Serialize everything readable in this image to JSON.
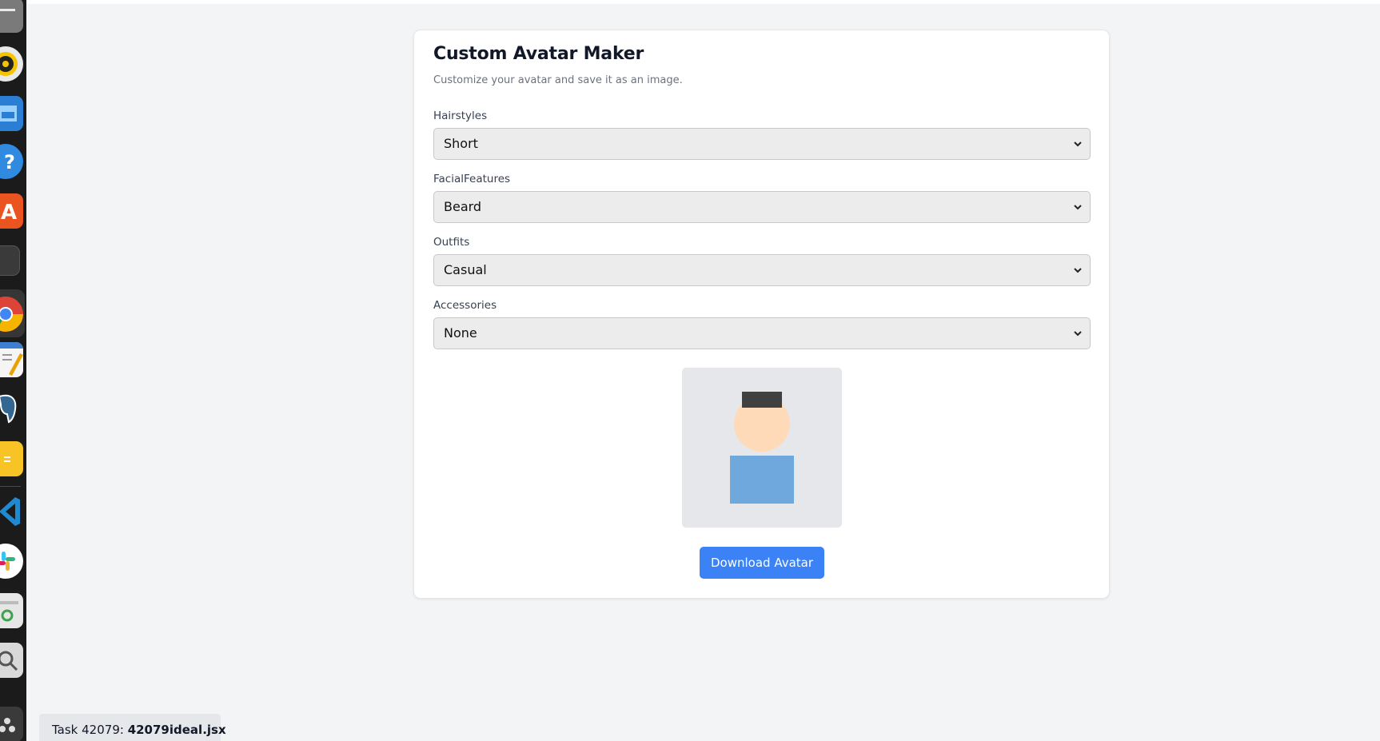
{
  "app": {
    "title": "Custom Avatar Maker",
    "subtitle": "Customize your avatar and save it as an image."
  },
  "fields": [
    {
      "label": "Hairstyles",
      "value": "Short"
    },
    {
      "label": "FacialFeatures",
      "value": "Beard"
    },
    {
      "label": "Outfits",
      "value": "Casual"
    },
    {
      "label": "Accessories",
      "value": "None"
    }
  ],
  "avatar": {
    "background_color": "#e5e7eb",
    "hair_color": "#404040",
    "skin_color": "#ffdab9",
    "outfit_color": "#6fa8dc"
  },
  "download_button": {
    "label": "Download Avatar",
    "color": "#3b82f6"
  },
  "footer": {
    "task_prefix": "Task 42079: ",
    "task_file": "42079ideal.jsx"
  },
  "dock": {
    "icons": [
      "files-icon",
      "rhythmbox-icon",
      "image-viewer-icon",
      "help-icon",
      "app-store-icon",
      "terminal-icon",
      "chrome-icon",
      "text-editor-icon",
      "postgresql-icon",
      "notes-icon",
      "vscode-icon",
      "slack-icon",
      "trash-icon",
      "search-icon",
      "show-apps-icon"
    ]
  }
}
